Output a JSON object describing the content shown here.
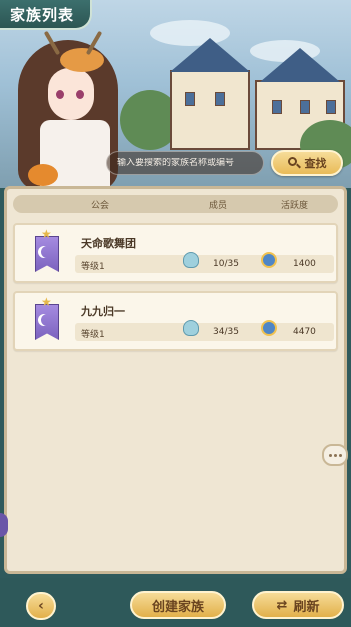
{
  "title": "家族列表",
  "search": {
    "placeholder": "输入要搜索的家族名称或编号",
    "button_label": "查找",
    "icon": "magnifier-icon"
  },
  "table": {
    "headers": [
      "公会",
      "成员",
      "活跃度"
    ],
    "rows": [
      {
        "name": "天命歌舞团",
        "level": "等级1",
        "members": "10/35",
        "activity": "1400",
        "badge_icon": "moon-banner-icon"
      },
      {
        "name": "九九归一",
        "level": "等级1",
        "members": "34/35",
        "activity": "4470",
        "badge_icon": "moon-banner-icon"
      }
    ]
  },
  "bottom": {
    "back_icon": "chevron-left-icon",
    "back_glyph": "‹",
    "create_label": "创建家族",
    "refresh_label": "刷新",
    "refresh_icon": "refresh-icon",
    "refresh_glyph": "⇄"
  },
  "colors": {
    "panel_bg": "#efe6d3",
    "button_gold": "#e9bb58",
    "frame_teal": "#2e595a",
    "badge_purple": "#7c63bf"
  }
}
